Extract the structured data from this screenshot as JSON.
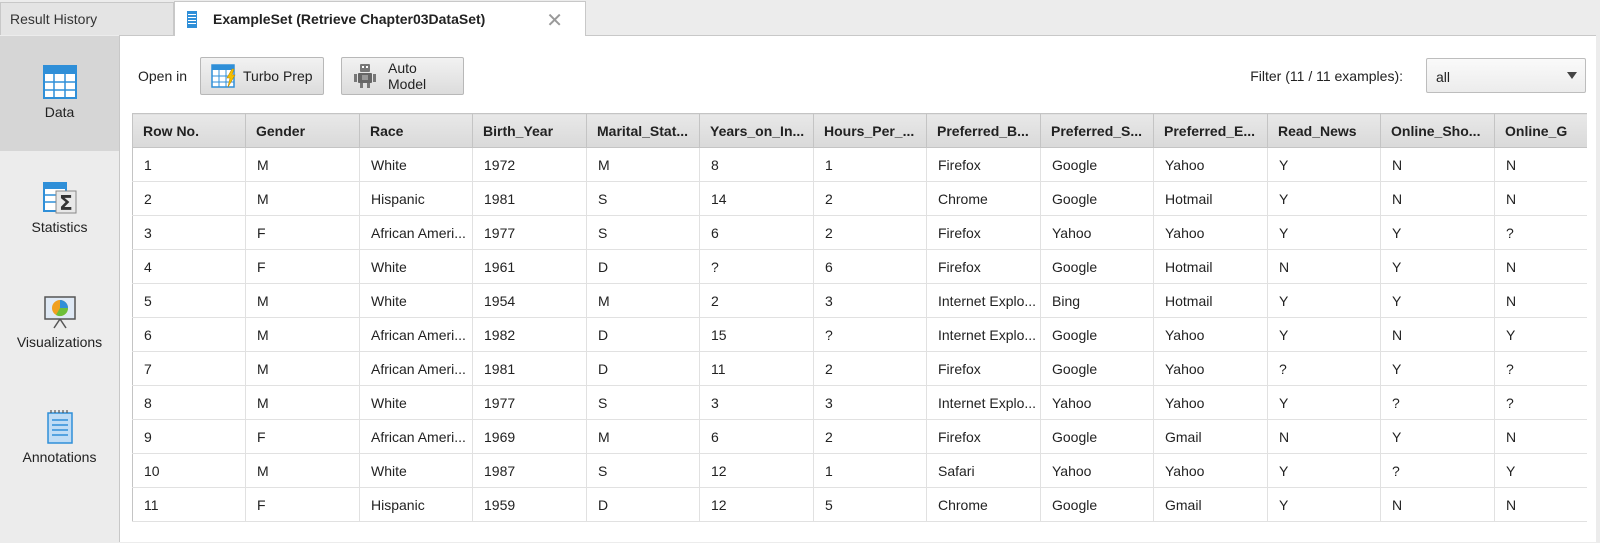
{
  "tabs": [
    {
      "label": "Result History"
    },
    {
      "label": "ExampleSet (Retrieve Chapter03DataSet)",
      "close": "✕"
    }
  ],
  "sidenav": [
    {
      "label": "Data",
      "icon": "table-icon"
    },
    {
      "label": "Statistics",
      "icon": "statistics-icon"
    },
    {
      "label": "Visualizations",
      "icon": "visualizations-icon"
    },
    {
      "label": "Annotations",
      "icon": "annotations-icon"
    }
  ],
  "toolbar": {
    "open_in_label": "Open in",
    "turbo_prep_label": "Turbo Prep",
    "auto_model_label": "Auto Model",
    "filter_label": "Filter (11 / 11 examples):",
    "filter_value": "all"
  },
  "table": {
    "columns": [
      "Row No.",
      "Gender",
      "Race",
      "Birth_Year",
      "Marital_Stat...",
      "Years_on_In...",
      "Hours_Per_...",
      "Preferred_B...",
      "Preferred_S...",
      "Preferred_E...",
      "Read_News",
      "Online_Sho...",
      "Online_G"
    ],
    "rows": [
      [
        "1",
        "M",
        "White",
        "1972",
        "M",
        "8",
        "1",
        "Firefox",
        "Google",
        "Yahoo",
        "Y",
        "N",
        "N"
      ],
      [
        "2",
        "M",
        "Hispanic",
        "1981",
        "S",
        "14",
        "2",
        "Chrome",
        "Google",
        "Hotmail",
        "Y",
        "N",
        "N"
      ],
      [
        "3",
        "F",
        "African Ameri...",
        "1977",
        "S",
        "6",
        "2",
        "Firefox",
        "Yahoo",
        "Yahoo",
        "Y",
        "Y",
        "?"
      ],
      [
        "4",
        "F",
        "White",
        "1961",
        "D",
        "?",
        "6",
        "Firefox",
        "Google",
        "Hotmail",
        "N",
        "Y",
        "N"
      ],
      [
        "5",
        "M",
        "White",
        "1954",
        "M",
        "2",
        "3",
        "Internet Explo...",
        "Bing",
        "Hotmail",
        "Y",
        "Y",
        "N"
      ],
      [
        "6",
        "M",
        "African Ameri...",
        "1982",
        "D",
        "15",
        "?",
        "Internet Explo...",
        "Google",
        "Yahoo",
        "Y",
        "N",
        "Y"
      ],
      [
        "7",
        "M",
        "African Ameri...",
        "1981",
        "D",
        "11",
        "2",
        "Firefox",
        "Google",
        "Yahoo",
        "?",
        "Y",
        "?"
      ],
      [
        "8",
        "M",
        "White",
        "1977",
        "S",
        "3",
        "3",
        "Internet Explo...",
        "Yahoo",
        "Yahoo",
        "Y",
        "?",
        "?"
      ],
      [
        "9",
        "F",
        "African Ameri...",
        "1969",
        "M",
        "6",
        "2",
        "Firefox",
        "Google",
        "Gmail",
        "N",
        "Y",
        "N"
      ],
      [
        "10",
        "M",
        "White",
        "1987",
        "S",
        "12",
        "1",
        "Safari",
        "Yahoo",
        "Yahoo",
        "Y",
        "?",
        "Y"
      ],
      [
        "11",
        "F",
        "Hispanic",
        "1959",
        "D",
        "12",
        "5",
        "Chrome",
        "Google",
        "Gmail",
        "Y",
        "N",
        "N"
      ]
    ]
  },
  "colors": {
    "accent_blue": "#2f8fd8",
    "active_nav_bg": "#d6d6d6",
    "header_bg": "#dddddd"
  }
}
